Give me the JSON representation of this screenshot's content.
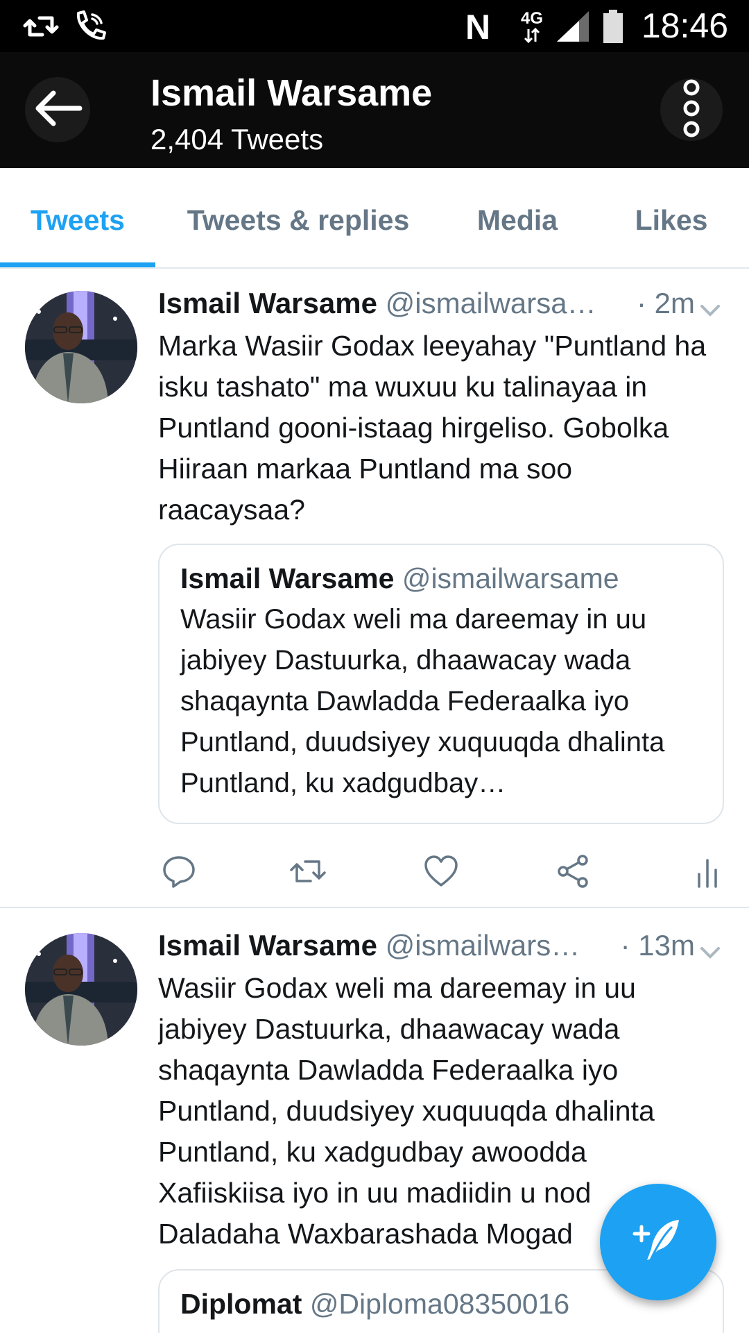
{
  "status_bar": {
    "time": "18:46",
    "icons": [
      "retweet-notification-icon",
      "wifi-calling-icon",
      "nfc-icon",
      "network-4g-icon",
      "signal-icon",
      "battery-icon"
    ],
    "network_label": "4G"
  },
  "header": {
    "title": "Ismail Warsame",
    "subtitle": "2,404 Tweets",
    "back_icon": "arrow-left-icon",
    "more_icon": "more-vertical-icon"
  },
  "tabs": [
    {
      "label": "Tweets",
      "active": true
    },
    {
      "label": "Tweets & replies",
      "active": false
    },
    {
      "label": "Media",
      "active": false
    },
    {
      "label": "Likes",
      "active": false
    }
  ],
  "tweets": [
    {
      "name": "Ismail Warsame",
      "handle": "@ismailwarsa…",
      "time": "· 2m",
      "text": "Marka Wasiir Godax leeyahay \"Puntland ha isku tashato\" ma wuxuu ku talinayaa in Puntland gooni-istaag hirgeliso. Gobolka Hiiraan markaa Puntland ma soo raacaysaa?",
      "quote": {
        "name": "Ismail Warsame",
        "handle": "@ismailwarsame",
        "text": "Wasiir Godax weli ma dareemay in uu jabiyey Dastuurka, dhaawacay wada shaqaynta Dawladda Federaalka iyo Puntland, duudsiyey xuquuqda dhalinta Puntland, ku xadgudbay…"
      },
      "actions": [
        "reply-icon",
        "retweet-icon",
        "like-icon",
        "share-icon",
        "analytics-icon"
      ]
    },
    {
      "name": "Ismail Warsame",
      "handle": "@ismailwars…",
      "time": "· 13m",
      "text": "Wasiir Godax weli ma dareemay in uu jabiyey Dastuurka, dhaawacay wada shaqaynta Dawladda Federaalka iyo Puntland, duudsiyey xuquuqda dhalinta Puntland, ku xadgudbay awoodda Xafiiskiisa iyo in uu madiidin u nod Daladaha Waxbarashada Mogad",
      "quote": {
        "name": "Diplomat",
        "handle": "@Diploma08350016"
      }
    }
  ],
  "fab_icon": "compose-tweet-icon",
  "colors": {
    "accent": "#1da1f2",
    "header_bg": "#0b0b0b",
    "secondary_text": "#657786"
  }
}
